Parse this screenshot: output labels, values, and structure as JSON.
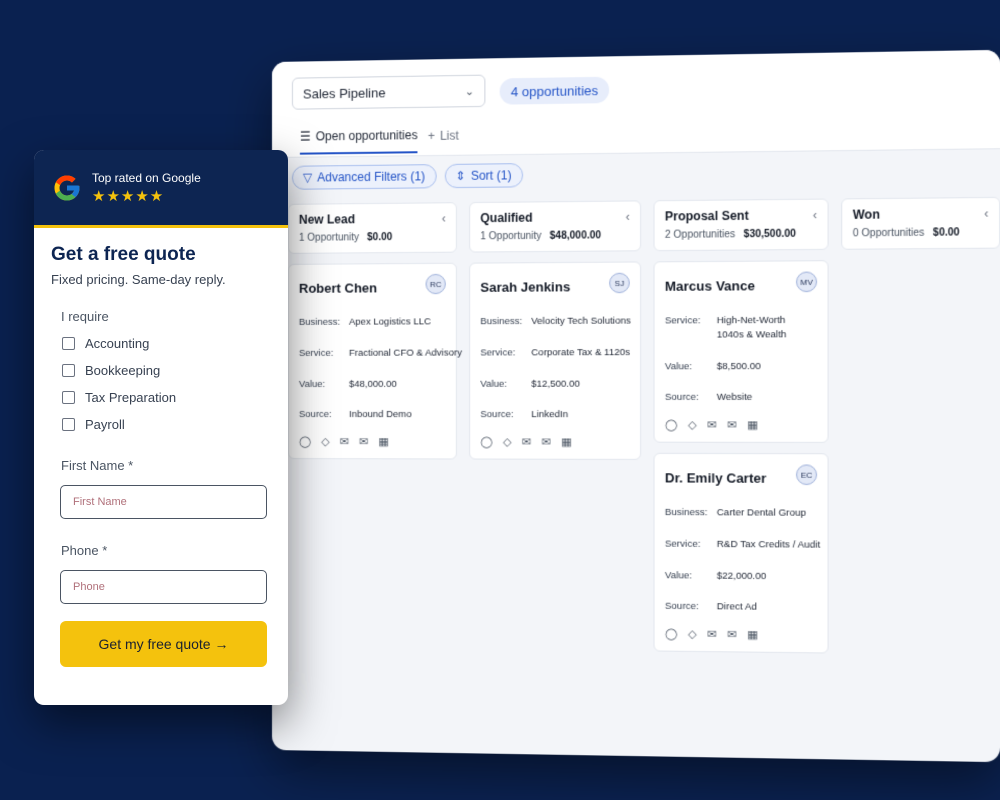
{
  "crm": {
    "pipeline_select": "Sales Pipeline",
    "opportunities_pill": "4 opportunities",
    "tabs": [
      {
        "icon": "list-icon",
        "label": "Open opportunities"
      },
      {
        "icon": "plus-icon",
        "label": "List"
      }
    ],
    "filters": {
      "advanced": "Advanced Filters (1)",
      "sort": "Sort (1)"
    },
    "labels": {
      "business": "Business:",
      "service": "Service:",
      "value": "Value:",
      "source": "Source:"
    },
    "columns": [
      {
        "title": "New Lead",
        "count": "1 Opportunity",
        "total": "$0.00",
        "cards": [
          {
            "name": "Robert Chen",
            "initials": "RC",
            "business": "Apex Logistics LLC",
            "service": "Fractional CFO & Advisory",
            "value": "$48,000.00",
            "source": "Inbound Demo"
          }
        ]
      },
      {
        "title": "Qualified",
        "count": "1 Opportunity",
        "total": "$48,000.00",
        "cards": [
          {
            "name": "Sarah Jenkins",
            "initials": "SJ",
            "business": "Velocity Tech Solutions",
            "service": "Corporate Tax & 1120s",
            "value": "$12,500.00",
            "source": "LinkedIn"
          }
        ]
      },
      {
        "title": "Proposal Sent",
        "count": "2 Opportunities",
        "total": "$30,500.00",
        "cards": [
          {
            "name": "Marcus Vance",
            "initials": "MV",
            "service": "High-Net-Worth 1040s & Wealth",
            "value": "$8,500.00",
            "source": "Website"
          },
          {
            "name": "Dr. Emily Carter",
            "initials": "EC",
            "business": "Carter Dental Group",
            "service": "R&D Tax Credits / Audit",
            "value": "$22,000.00",
            "source": "Direct Ad"
          }
        ]
      },
      {
        "title": "Won",
        "count": "0 Opportunities",
        "total": "$0.00",
        "cards": []
      }
    ]
  },
  "quote": {
    "badge_text": "Top rated on Google",
    "stars": "★★★★★",
    "rating": 5,
    "title": "Get a free quote",
    "subtitle": "Fixed pricing. Same-day reply.",
    "require_label": "I require",
    "options": [
      "Accounting",
      "Bookkeeping",
      "Tax Preparation",
      "Payroll"
    ],
    "first_name_label": "First Name *",
    "first_name_placeholder": "First Name",
    "phone_label": "Phone *",
    "phone_placeholder": "Phone",
    "cta": "Get my free quote →"
  },
  "colors": {
    "background": "#0a2150",
    "accent_blue": "#2454c7",
    "cta_yellow": "#f4c20d",
    "header_navy": "#0d2552"
  }
}
